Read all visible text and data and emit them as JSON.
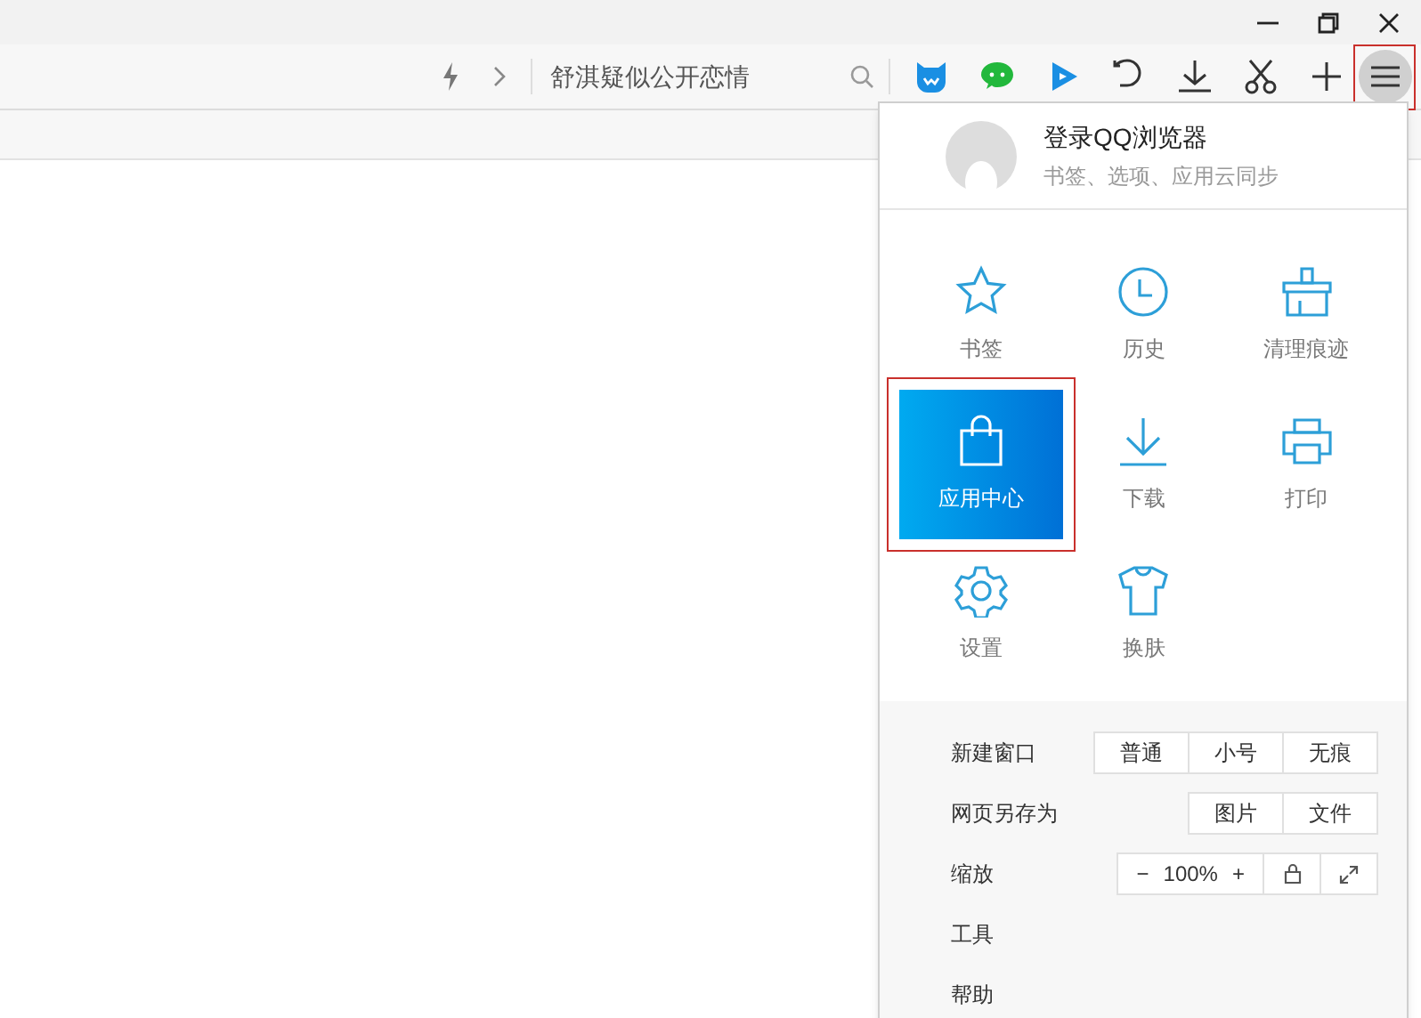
{
  "toolbar": {
    "search_text": "舒淇疑似公开恋情",
    "menu_annotated": true
  },
  "account": {
    "title": "登录QQ浏览器",
    "subtitle": "书签、选项、应用云同步"
  },
  "menu_grid": [
    {
      "label": "书签",
      "kind": "star",
      "selected": false,
      "annotated": false
    },
    {
      "label": "历史",
      "kind": "clock",
      "selected": false,
      "annotated": false
    },
    {
      "label": "清理痕迹",
      "kind": "broom",
      "selected": false,
      "annotated": false
    },
    {
      "label": "应用中心",
      "kind": "bag",
      "selected": true,
      "annotated": true
    },
    {
      "label": "下载",
      "kind": "download",
      "selected": false,
      "annotated": false
    },
    {
      "label": "打印",
      "kind": "printer",
      "selected": false,
      "annotated": false
    },
    {
      "label": "设置",
      "kind": "gear",
      "selected": false,
      "annotated": false
    },
    {
      "label": "换肤",
      "kind": "shirt",
      "selected": false,
      "annotated": false
    }
  ],
  "options": [
    {
      "label": "新建窗口",
      "buttons": [
        "普通",
        "小号",
        "无痕"
      ]
    },
    {
      "label": "网页另存为",
      "buttons": [
        "图片",
        "文件"
      ]
    }
  ],
  "zoom": {
    "label": "缩放",
    "minus": "−",
    "value": "100%",
    "plus": "+"
  },
  "more": [
    {
      "label": "工具"
    },
    {
      "label": "帮助"
    }
  ]
}
